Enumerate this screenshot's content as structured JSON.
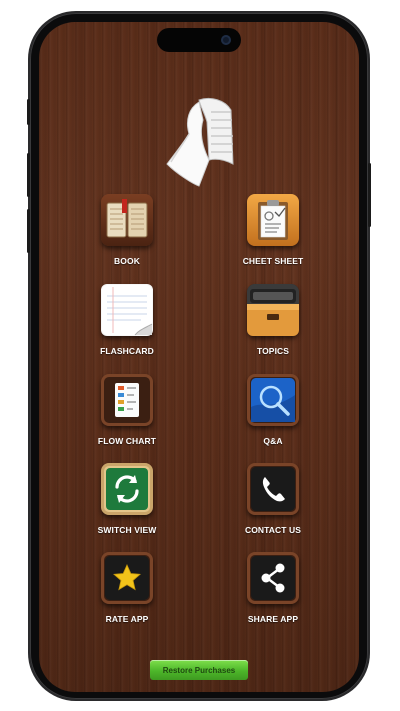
{
  "app": {
    "tiles": [
      {
        "label": "BOOK",
        "icon": "book-icon"
      },
      {
        "label": "CHEET SHEET",
        "icon": "clipboard-icon"
      },
      {
        "label": "FLASHCARD",
        "icon": "notepad-icon"
      },
      {
        "label": "TOPICS",
        "icon": "drawer-icon"
      },
      {
        "label": "FLOW CHART",
        "icon": "flowchart-icon"
      },
      {
        "label": "Q&A",
        "icon": "magnifier-icon"
      },
      {
        "label": "SWITCH VIEW",
        "icon": "refresh-icon"
      },
      {
        "label": "CONTACT US",
        "icon": "phone-icon"
      },
      {
        "label": "RATE APP",
        "icon": "star-icon"
      },
      {
        "label": "SHARE APP",
        "icon": "share-icon"
      }
    ],
    "restore_label": "Restore Purchases"
  },
  "colors": {
    "wood": "#5a2d1a",
    "restore_green": "#4db62a",
    "frame_brown": "#7a4428"
  }
}
